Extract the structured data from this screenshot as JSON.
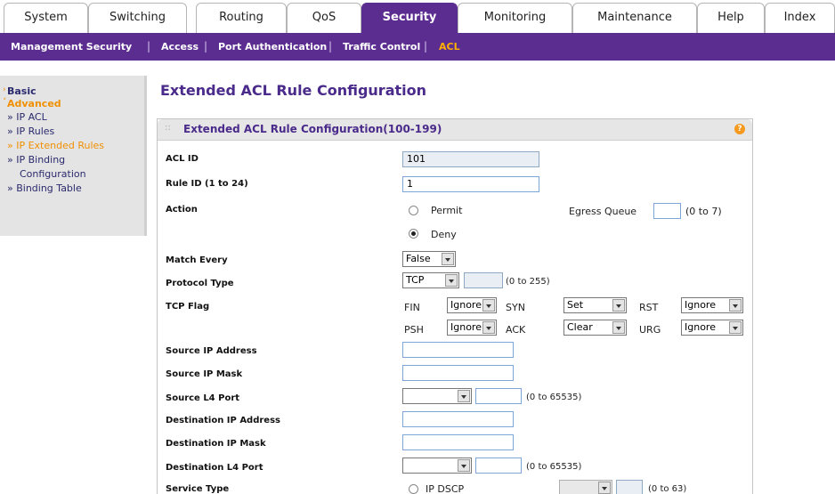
{
  "tabs": [
    {
      "label": "System"
    },
    {
      "label": "Switching"
    },
    {
      "label": "Routing"
    },
    {
      "label": "QoS"
    },
    {
      "label": "Security"
    },
    {
      "label": "Monitoring"
    },
    {
      "label": "Maintenance"
    },
    {
      "label": "Help"
    },
    {
      "label": "Index"
    }
  ],
  "subnav": {
    "items": [
      "Management Security",
      "Access",
      "Port Authentication",
      "Traffic Control",
      "ACL"
    ],
    "separator": "|"
  },
  "leftnav": {
    "basic": "Basic",
    "advanced": "Advanced",
    "items": [
      "» IP ACL",
      "» IP Rules",
      "» IP Extended Rules",
      "» IP Binding",
      "Configuration",
      "» Binding Table"
    ]
  },
  "page_title": "Extended ACL Rule Configuration",
  "panel": {
    "title": "Extended ACL Rule Configuration(100-199)",
    "help": "?"
  },
  "form": {
    "acl_id": {
      "label": "ACL ID",
      "value": "101"
    },
    "rule_id": {
      "label": "Rule ID (1 to 24)",
      "value": "1"
    },
    "action": {
      "label": "Action",
      "permit": "Permit",
      "deny": "Deny",
      "selected": "Deny",
      "egress_label": "Egress Queue",
      "egress_value": "",
      "egress_range": "(0 to 7)"
    },
    "match_every": {
      "label": "Match Every",
      "value": "False"
    },
    "protocol_type": {
      "label": "Protocol Type",
      "value": "TCP",
      "number": "",
      "range": "(0 to 255)"
    },
    "tcp_flag": {
      "label": "TCP Flag",
      "flags": [
        {
          "name": "FIN",
          "value": "Ignore"
        },
        {
          "name": "SYN",
          "value": "Set"
        },
        {
          "name": "RST",
          "value": "Ignore"
        },
        {
          "name": "PSH",
          "value": "Ignore"
        },
        {
          "name": "ACK",
          "value": "Clear"
        },
        {
          "name": "URG",
          "value": "Ignore"
        }
      ]
    },
    "source_ip": {
      "label": "Source IP Address",
      "value": ""
    },
    "source_mask": {
      "label": "Source IP Mask",
      "value": ""
    },
    "source_l4": {
      "label": "Source L4 Port",
      "value": "",
      "port": "",
      "range": "(0 to 65535)"
    },
    "dest_ip": {
      "label": "Destination IP Address",
      "value": ""
    },
    "dest_mask": {
      "label": "Destination IP Mask",
      "value": ""
    },
    "dest_l4": {
      "label": "Destination L4 Port",
      "value": "",
      "port": "",
      "range": "(0 to 65535)"
    },
    "service_type": {
      "label": "Service Type",
      "option": "IP DSCP",
      "range": "(0 to 63)"
    }
  }
}
